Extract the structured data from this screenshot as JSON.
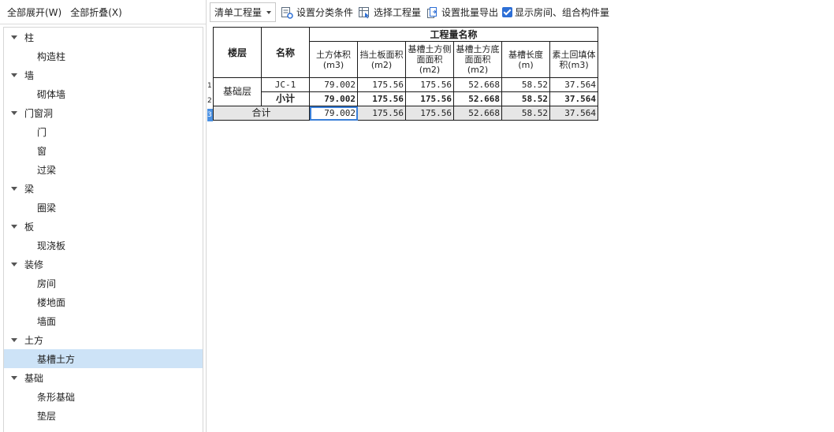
{
  "left_toolbar": {
    "expand_all": "全部展开(W)",
    "collapse_all": "全部折叠(X)"
  },
  "tree": [
    {
      "label": "柱",
      "children": [
        "构造柱"
      ]
    },
    {
      "label": "墙",
      "children": [
        "砌体墙"
      ]
    },
    {
      "label": "门窗洞",
      "children": [
        "门",
        "窗",
        "过梁"
      ]
    },
    {
      "label": "梁",
      "children": [
        "圈梁"
      ]
    },
    {
      "label": "板",
      "children": [
        "现浇板"
      ]
    },
    {
      "label": "装修",
      "children": [
        "房间",
        "楼地面",
        "墙面"
      ]
    },
    {
      "label": "土方",
      "children": [
        "基槽土方"
      ]
    },
    {
      "label": "基础",
      "children": [
        "条形基础",
        "垫层"
      ]
    }
  ],
  "selected_tree_item": "基槽土方",
  "toolbar": {
    "select_value": "清单工程量",
    "set_category": "设置分类条件",
    "select_qty": "选择工程量",
    "batch_export": "设置批量导出",
    "show_rooms": "显示房间、组合构件量",
    "show_rooms_checked": true
  },
  "table": {
    "group_header": "工程量名称",
    "col_floor": "楼层",
    "col_name": "名称",
    "columns": [
      "土方体积(m3)",
      "挡土板面积(m2)",
      "基槽土方侧面面积(m2)",
      "基槽土方底面面积(m2)",
      "基槽长度(m)",
      "素土回填体积(m3)"
    ],
    "floor": "基础层",
    "rows": [
      {
        "name": "JC-1",
        "values": [
          "79.002",
          "175.56",
          "175.56",
          "52.668",
          "58.52",
          "37.564"
        ]
      },
      {
        "name": "小计",
        "values": [
          "79.002",
          "175.56",
          "175.56",
          "52.668",
          "58.52",
          "37.564"
        ]
      }
    ],
    "total": {
      "label": "合计",
      "values": [
        "79.002",
        "175.56",
        "175.56",
        "52.668",
        "58.52",
        "37.564"
      ]
    },
    "row_numbers": [
      "1",
      "2",
      "3"
    ]
  },
  "colors": {
    "selected_bg": "#cde3f7",
    "check_blue": "#2d6fd6",
    "total_bg": "#e6e6e6"
  }
}
